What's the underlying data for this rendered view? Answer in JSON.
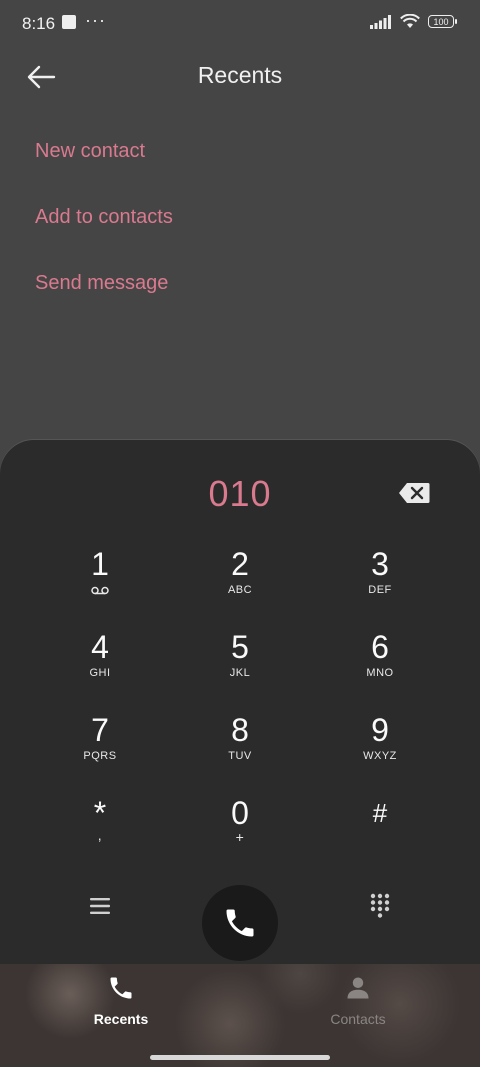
{
  "status_bar": {
    "time": "8:16",
    "more_dots": "···",
    "battery": "100"
  },
  "header": {
    "title": "Recents"
  },
  "options": [
    {
      "label": "New contact"
    },
    {
      "label": "Add to contacts"
    },
    {
      "label": "Send message"
    }
  ],
  "dialer": {
    "number": "010",
    "keys": [
      {
        "digit": "1",
        "letters": ""
      },
      {
        "digit": "2",
        "letters": "ABC"
      },
      {
        "digit": "3",
        "letters": "DEF"
      },
      {
        "digit": "4",
        "letters": "GHI"
      },
      {
        "digit": "5",
        "letters": "JKL"
      },
      {
        "digit": "6",
        "letters": "MNO"
      },
      {
        "digit": "7",
        "letters": "PQRS"
      },
      {
        "digit": "8",
        "letters": "TUV"
      },
      {
        "digit": "9",
        "letters": "WXYZ"
      },
      {
        "digit": "*",
        "letters": ","
      },
      {
        "digit": "0",
        "letters": "+"
      },
      {
        "digit": "#",
        "letters": ""
      }
    ]
  },
  "bottom_nav": {
    "recents_label": "Recents",
    "contacts_label": "Contacts"
  },
  "colors": {
    "accent": "#d97a8f",
    "background": "#454545",
    "dialer_background": "#2b2b2b"
  }
}
